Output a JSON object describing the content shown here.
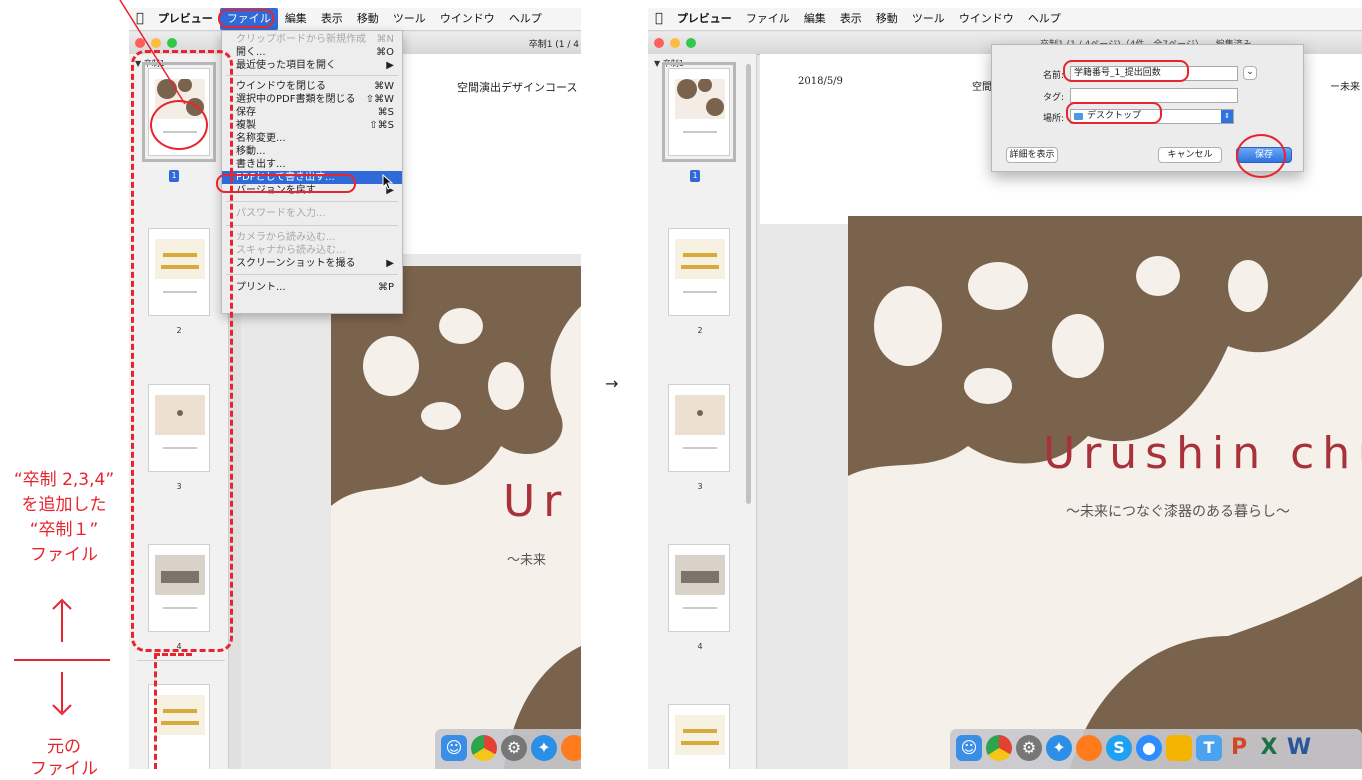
{
  "menubar": {
    "apple": "",
    "items": [
      "プレビュー",
      "ファイル",
      "編集",
      "表示",
      "移動",
      "ツール",
      "ウインドウ",
      "ヘルプ"
    ]
  },
  "left_window": {
    "title": "卒制1 (1 / 4",
    "sidebar_header": "卒制1",
    "page_numbers": [
      "1",
      "2",
      "3",
      "4"
    ],
    "header_text": "空間演出デザインコース",
    "title_en": "Ur",
    "subtitle_jp": "～未来"
  },
  "file_menu": {
    "items": [
      {
        "label": "クリップボードから新規作成",
        "shortcut": "⌘N",
        "disabled": true
      },
      {
        "label": "開く...",
        "shortcut": "⌘O"
      },
      {
        "label": "最近使った項目を開く",
        "shortcut": "▶"
      },
      {
        "label": "ウインドウを閉じる",
        "shortcut": "⌘W"
      },
      {
        "label": "選択中のPDF書類を閉じる",
        "shortcut": "⇧⌘W"
      },
      {
        "label": "保存",
        "shortcut": "⌘S"
      },
      {
        "label": "複製",
        "shortcut": "⇧⌘S"
      },
      {
        "label": "名称変更...",
        "shortcut": ""
      },
      {
        "label": "移動...",
        "shortcut": ""
      },
      {
        "label": "書き出す...",
        "shortcut": ""
      },
      {
        "label": "PDFとして書き出す...",
        "shortcut": "",
        "highlighted": true
      },
      {
        "label": "バージョンを戻す",
        "shortcut": "▶"
      },
      {
        "label": "パスワードを入力...",
        "shortcut": "",
        "disabled": true
      },
      {
        "label": "カメラから読み込む...",
        "shortcut": "",
        "disabled": true
      },
      {
        "label": "スキャナから読み込む...",
        "shortcut": "",
        "disabled": true
      },
      {
        "label": "スクリーンショットを撮る",
        "shortcut": "▶"
      },
      {
        "label": "プリント...",
        "shortcut": "⌘P"
      }
    ]
  },
  "annotation": {
    "top_text": "“卒制 2,3,4”\nを追加した\n“卒制１”\nファイル",
    "bottom_text": "元の\nファイル",
    "arrow_between": "→"
  },
  "right_window": {
    "title": "卒制1 (1 / 4ページ)（4件、全7ページ）— 編集済み",
    "sidebar_header": "卒制1",
    "page_numbers": [
      "1",
      "2",
      "3",
      "4"
    ],
    "date": "2018/5/9",
    "header_left": "空間",
    "header_right": "ー未来",
    "title_en": "Urushin chu",
    "subtitle_jp": "～未来につなぐ漆器のある暮らし～"
  },
  "dialog": {
    "name_label": "名前:",
    "name_value": "学籍番号_1_提出回数",
    "tag_label": "タグ:",
    "location_label": "場所:",
    "location_value": "デスクトップ",
    "details_button": "詳細を表示",
    "cancel_button": "キャンセル",
    "save_button": "保存"
  }
}
